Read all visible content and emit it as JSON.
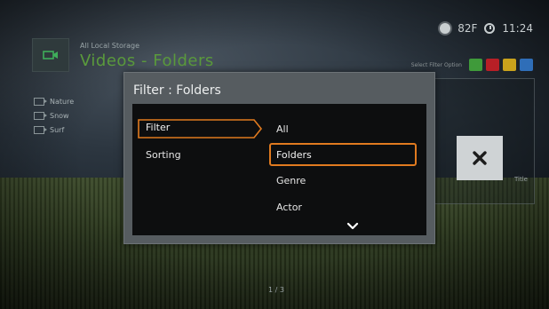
{
  "header": {
    "breadcrumb": "All Local Storage",
    "title": "Videos - Folders"
  },
  "status_bar": {
    "temperature": "82F",
    "time": "11:24",
    "weather_icon": "weather-icon",
    "clock_icon": "clock-icon"
  },
  "sidebar": {
    "items": [
      {
        "label": "Nature",
        "icon": "video-icon"
      },
      {
        "label": "Snow",
        "icon": "video-icon"
      },
      {
        "label": "Surf",
        "icon": "video-icon"
      }
    ]
  },
  "color_keys": {
    "label": "Select Filter Option",
    "colors": [
      "#3f9a3a",
      "#b71f26",
      "#c9a21c",
      "#2f6eb8"
    ]
  },
  "right_panel": {
    "meta": "Title"
  },
  "dialog": {
    "title": "Filter : Folders",
    "categories": [
      {
        "label": "Filter",
        "selected": true
      },
      {
        "label": "Sorting",
        "selected": false
      }
    ],
    "options": [
      {
        "label": "All"
      },
      {
        "label": "Folders",
        "selected": true
      },
      {
        "label": "Genre"
      },
      {
        "label": "Actor"
      }
    ]
  },
  "footer": {
    "page": "1 / 3"
  },
  "colors": {
    "accent": "#e07a1f",
    "title_green": "#5a9a3c"
  }
}
